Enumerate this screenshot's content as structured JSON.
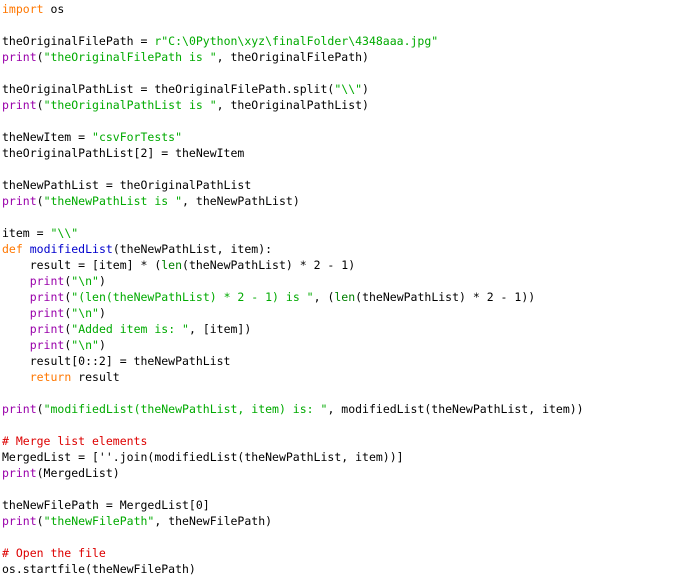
{
  "editor": {
    "language": "Python",
    "background_color": "#ffffff",
    "font_size_px": 11.5,
    "line_height_px": 16,
    "colors": {
      "keyword": "#ff7700",
      "builtin": "#008000",
      "function_name": "#0000cd",
      "print_name": "#9900aa",
      "string": "#00aa00",
      "comment": "#dd0000",
      "plain": "#000000"
    }
  },
  "code": {
    "lines": [
      {
        "id": 1,
        "text": "import os"
      },
      {
        "id": 2,
        "text": ""
      },
      {
        "id": 3,
        "text": "theOriginalFilePath = r\"C:\\0Python\\xyz\\finalFolder\\4348aaa.jpg\""
      },
      {
        "id": 4,
        "text": "print(\"theOriginalFilePath is \", theOriginalFilePath)"
      },
      {
        "id": 5,
        "text": ""
      },
      {
        "id": 6,
        "text": "theOriginalPathList = theOriginalFilePath.split(\"\\\\\")"
      },
      {
        "id": 7,
        "text": "print(\"theOriginalPathList is \", theOriginalPathList)"
      },
      {
        "id": 8,
        "text": ""
      },
      {
        "id": 9,
        "text": "theNewItem = \"csvForTests\""
      },
      {
        "id": 10,
        "text": "theOriginalPathList[2] = theNewItem"
      },
      {
        "id": 11,
        "text": ""
      },
      {
        "id": 12,
        "text": "theNewPathList = theOriginalPathList"
      },
      {
        "id": 13,
        "text": "print(\"theNewPathList is \", theNewPathList)"
      },
      {
        "id": 14,
        "text": ""
      },
      {
        "id": 15,
        "text": "item = \"\\\\\""
      },
      {
        "id": 16,
        "text": "def modifiedList(theNewPathList, item):"
      },
      {
        "id": 17,
        "text": "    result = [item] * (len(theNewPathList) * 2 - 1)"
      },
      {
        "id": 18,
        "text": "    print(\"\\n\")"
      },
      {
        "id": 19,
        "text": "    print(\"(len(theNewPathList) * 2 - 1) is \", (len(theNewPathList) * 2 - 1))"
      },
      {
        "id": 20,
        "text": "    print(\"\\n\")"
      },
      {
        "id": 21,
        "text": "    print(\"Added item is: \", [item])"
      },
      {
        "id": 22,
        "text": "    print(\"\\n\")"
      },
      {
        "id": 23,
        "text": "    result[0::2] = theNewPathList"
      },
      {
        "id": 24,
        "text": "    return result"
      },
      {
        "id": 25,
        "text": ""
      },
      {
        "id": 26,
        "text": "print(\"modifiedList(theNewPathList, item) is: \", modifiedList(theNewPathList, item))"
      },
      {
        "id": 27,
        "text": ""
      },
      {
        "id": 28,
        "text": "# Merge list elements"
      },
      {
        "id": 29,
        "text": "MergedList = [''.join(modifiedList(theNewPathList, item))]"
      },
      {
        "id": 30,
        "text": "print(MergedList)"
      },
      {
        "id": 31,
        "text": ""
      },
      {
        "id": 32,
        "text": "theNewFilePath = MergedList[0]"
      },
      {
        "id": 33,
        "text": "print(\"theNewFilePath\", theNewFilePath)"
      },
      {
        "id": 34,
        "text": ""
      },
      {
        "id": 35,
        "text": "# Open the file"
      },
      {
        "id": 36,
        "text": "os.startfile(theNewFilePath)"
      }
    ],
    "tokenized": [
      [
        {
          "t": "import",
          "c": "kw"
        },
        {
          "t": " os",
          "c": "plain"
        }
      ],
      [],
      [
        {
          "t": "theOriginalFilePath = ",
          "c": "plain"
        },
        {
          "t": "r\"C:\\0Python\\xyz\\finalFolder\\4348aaa.jpg\"",
          "c": "string"
        }
      ],
      [
        {
          "t": "print",
          "c": "print"
        },
        {
          "t": "(",
          "c": "plain"
        },
        {
          "t": "\"theOriginalFilePath is \"",
          "c": "string"
        },
        {
          "t": ", theOriginalFilePath)",
          "c": "plain"
        }
      ],
      [],
      [
        {
          "t": "theOriginalPathList = theOriginalFilePath.split(",
          "c": "plain"
        },
        {
          "t": "\"\\\\\"",
          "c": "string"
        },
        {
          "t": ")",
          "c": "plain"
        }
      ],
      [
        {
          "t": "print",
          "c": "print"
        },
        {
          "t": "(",
          "c": "plain"
        },
        {
          "t": "\"theOriginalPathList is \"",
          "c": "string"
        },
        {
          "t": ", theOriginalPathList)",
          "c": "plain"
        }
      ],
      [],
      [
        {
          "t": "theNewItem = ",
          "c": "plain"
        },
        {
          "t": "\"csvForTests\"",
          "c": "string"
        }
      ],
      [
        {
          "t": "theOriginalPathList[2] = theNewItem",
          "c": "plain"
        }
      ],
      [],
      [
        {
          "t": "theNewPathList = theOriginalPathList",
          "c": "plain"
        }
      ],
      [
        {
          "t": "print",
          "c": "print"
        },
        {
          "t": "(",
          "c": "plain"
        },
        {
          "t": "\"theNewPathList is \"",
          "c": "string"
        },
        {
          "t": ", theNewPathList)",
          "c": "plain"
        }
      ],
      [],
      [
        {
          "t": "item = ",
          "c": "plain"
        },
        {
          "t": "\"\\\\\"",
          "c": "string"
        }
      ],
      [
        {
          "t": "def",
          "c": "kw"
        },
        {
          "t": " ",
          "c": "plain"
        },
        {
          "t": "modifiedList",
          "c": "func"
        },
        {
          "t": "(theNewPathList, item):",
          "c": "plain"
        }
      ],
      [
        {
          "t": "    result = [item] * (",
          "c": "plain"
        },
        {
          "t": "len",
          "c": "builtin"
        },
        {
          "t": "(theNewPathList) * 2 - 1)",
          "c": "plain"
        }
      ],
      [
        {
          "t": "    ",
          "c": "plain"
        },
        {
          "t": "print",
          "c": "print"
        },
        {
          "t": "(",
          "c": "plain"
        },
        {
          "t": "\"\\n\"",
          "c": "string"
        },
        {
          "t": ")",
          "c": "plain"
        }
      ],
      [
        {
          "t": "    ",
          "c": "plain"
        },
        {
          "t": "print",
          "c": "print"
        },
        {
          "t": "(",
          "c": "plain"
        },
        {
          "t": "\"(len(theNewPathList) * 2 - 1) is \"",
          "c": "string"
        },
        {
          "t": ", (",
          "c": "plain"
        },
        {
          "t": "len",
          "c": "builtin"
        },
        {
          "t": "(theNewPathList) * 2 - 1))",
          "c": "plain"
        }
      ],
      [
        {
          "t": "    ",
          "c": "plain"
        },
        {
          "t": "print",
          "c": "print"
        },
        {
          "t": "(",
          "c": "plain"
        },
        {
          "t": "\"\\n\"",
          "c": "string"
        },
        {
          "t": ")",
          "c": "plain"
        }
      ],
      [
        {
          "t": "    ",
          "c": "plain"
        },
        {
          "t": "print",
          "c": "print"
        },
        {
          "t": "(",
          "c": "plain"
        },
        {
          "t": "\"Added item is: \"",
          "c": "string"
        },
        {
          "t": ", [item])",
          "c": "plain"
        }
      ],
      [
        {
          "t": "    ",
          "c": "plain"
        },
        {
          "t": "print",
          "c": "print"
        },
        {
          "t": "(",
          "c": "plain"
        },
        {
          "t": "\"\\n\"",
          "c": "string"
        },
        {
          "t": ")",
          "c": "plain"
        }
      ],
      [
        {
          "t": "    result[0::2] = theNewPathList",
          "c": "plain"
        }
      ],
      [
        {
          "t": "    ",
          "c": "plain"
        },
        {
          "t": "return",
          "c": "kw"
        },
        {
          "t": " result",
          "c": "plain"
        }
      ],
      [],
      [
        {
          "t": "print",
          "c": "print"
        },
        {
          "t": "(",
          "c": "plain"
        },
        {
          "t": "\"modifiedList(theNewPathList, item) is: \"",
          "c": "string"
        },
        {
          "t": ", modifiedList(theNewPathList, item))",
          "c": "plain"
        }
      ],
      [],
      [
        {
          "t": "# Merge list elements",
          "c": "comment"
        }
      ],
      [
        {
          "t": "MergedList = [''.join(modifiedList(theNewPathList, item))]",
          "c": "plain"
        }
      ],
      [
        {
          "t": "print",
          "c": "print"
        },
        {
          "t": "(MergedList)",
          "c": "plain"
        }
      ],
      [],
      [
        {
          "t": "theNewFilePath = MergedList[0]",
          "c": "plain"
        }
      ],
      [
        {
          "t": "print",
          "c": "print"
        },
        {
          "t": "(",
          "c": "plain"
        },
        {
          "t": "\"theNewFilePath\"",
          "c": "string"
        },
        {
          "t": ", theNewFilePath)",
          "c": "plain"
        }
      ],
      [],
      [
        {
          "t": "# Open the file",
          "c": "comment"
        }
      ],
      [
        {
          "t": "os.startfile(theNewFilePath)",
          "c": "plain"
        }
      ]
    ]
  }
}
